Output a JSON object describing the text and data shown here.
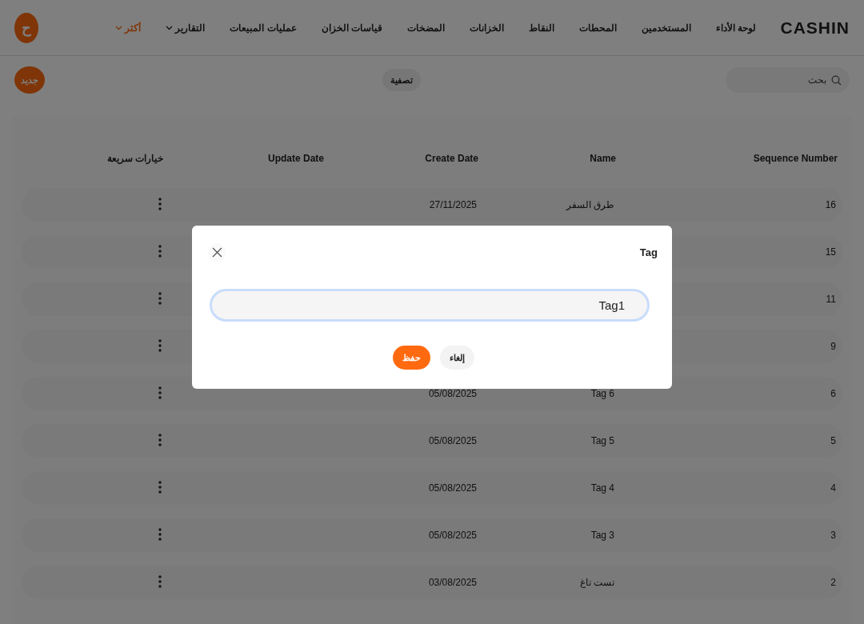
{
  "header": {
    "logo": "CASHIN",
    "avatar": "ح",
    "nav": [
      {
        "label": "لوحة الأداء",
        "selected": false,
        "dropdown": false
      },
      {
        "label": "المستخدمين",
        "selected": false,
        "dropdown": false
      },
      {
        "label": "المحطات",
        "selected": false,
        "dropdown": false
      },
      {
        "label": "النقاط",
        "selected": false,
        "dropdown": false
      },
      {
        "label": "الخزانات",
        "selected": false,
        "dropdown": false
      },
      {
        "label": "المضخات",
        "selected": false,
        "dropdown": false
      },
      {
        "label": "قياسات الخزان",
        "selected": false,
        "dropdown": false
      },
      {
        "label": "عمليات المبيعات",
        "selected": false,
        "dropdown": false
      },
      {
        "label": "التقارير",
        "selected": false,
        "dropdown": true
      },
      {
        "label": "أكثر",
        "selected": true,
        "dropdown": true
      }
    ]
  },
  "toolbar": {
    "search": {
      "placeholder": "بحث"
    },
    "filter_button": "تصفية",
    "new_button": "جديد"
  },
  "table": {
    "columns": [
      "Sequence Number",
      "Name",
      "Create Date",
      "Update Date",
      "خيارات سريعة"
    ],
    "rows": [
      {
        "sequence": "16",
        "name": "طرق السفر",
        "create_date": "27/11/2025"
      },
      {
        "sequence": "15"
      },
      {
        "sequence": "11"
      },
      {
        "sequence": "9"
      },
      {
        "sequence": "6",
        "name": "Tag 6",
        "create_date": "05/08/2025"
      },
      {
        "sequence": "5",
        "name": "Tag 5",
        "create_date": "05/08/2025"
      },
      {
        "sequence": "4",
        "name": "Tag 4",
        "create_date": "05/08/2025"
      },
      {
        "sequence": "3",
        "name": "Tag 3",
        "create_date": "05/08/2025"
      },
      {
        "sequence": "2",
        "name": "تست تاغ",
        "create_date": "03/08/2025"
      }
    ]
  },
  "dialog": {
    "title": "Tag",
    "input": {
      "value": "Tag1",
      "focused": true
    },
    "buttons": [
      {
        "label": "إلغاء",
        "kind": "secondary"
      },
      {
        "label": "حفظ",
        "kind": "primary"
      }
    ]
  }
}
